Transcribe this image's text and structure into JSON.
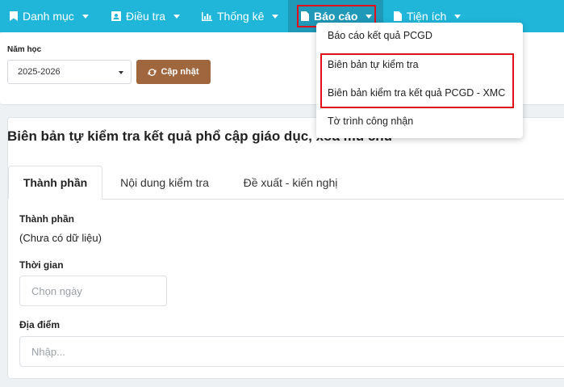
{
  "navbar": {
    "items": [
      {
        "label": "Danh mục",
        "icon": "bookmark-icon"
      },
      {
        "label": "Điều tra",
        "icon": "id-card-icon"
      },
      {
        "label": "Thống kê",
        "icon": "bar-chart-icon"
      },
      {
        "label": "Báo cáo",
        "icon": "document-icon"
      },
      {
        "label": "Tiện ích",
        "icon": "document-icon"
      }
    ],
    "active_color": "#2098b8",
    "color": "#1fb6d9"
  },
  "dropdown": {
    "items": [
      "Báo cáo kết quả PCGD",
      "Biên bản tự kiểm tra",
      "Biên bản kiểm tra kết quả PCGD - XMC",
      "Tờ trình công nhận"
    ]
  },
  "filter": {
    "school_year_label": "Năm học",
    "school_year_value": "2025-2026",
    "update_button": "Cập nhật",
    "update_button_color": "#a0663e"
  },
  "form": {
    "title": "Biên bản tự kiểm tra kết quả phổ cập giáo dục, xóa mù chữ",
    "tabs": [
      "Thành phần",
      "Nội dung kiểm tra",
      "Đề xuất - kiến nghị"
    ],
    "composition_label": "Thành phần",
    "composition_value": "(Chưa có dữ liệu)",
    "time_label": "Thời gian",
    "time_placeholder": "Chọn ngày",
    "location_label": "Địa điểm",
    "location_placeholder": "Nhập..."
  },
  "highlight_color": "#e0101b"
}
